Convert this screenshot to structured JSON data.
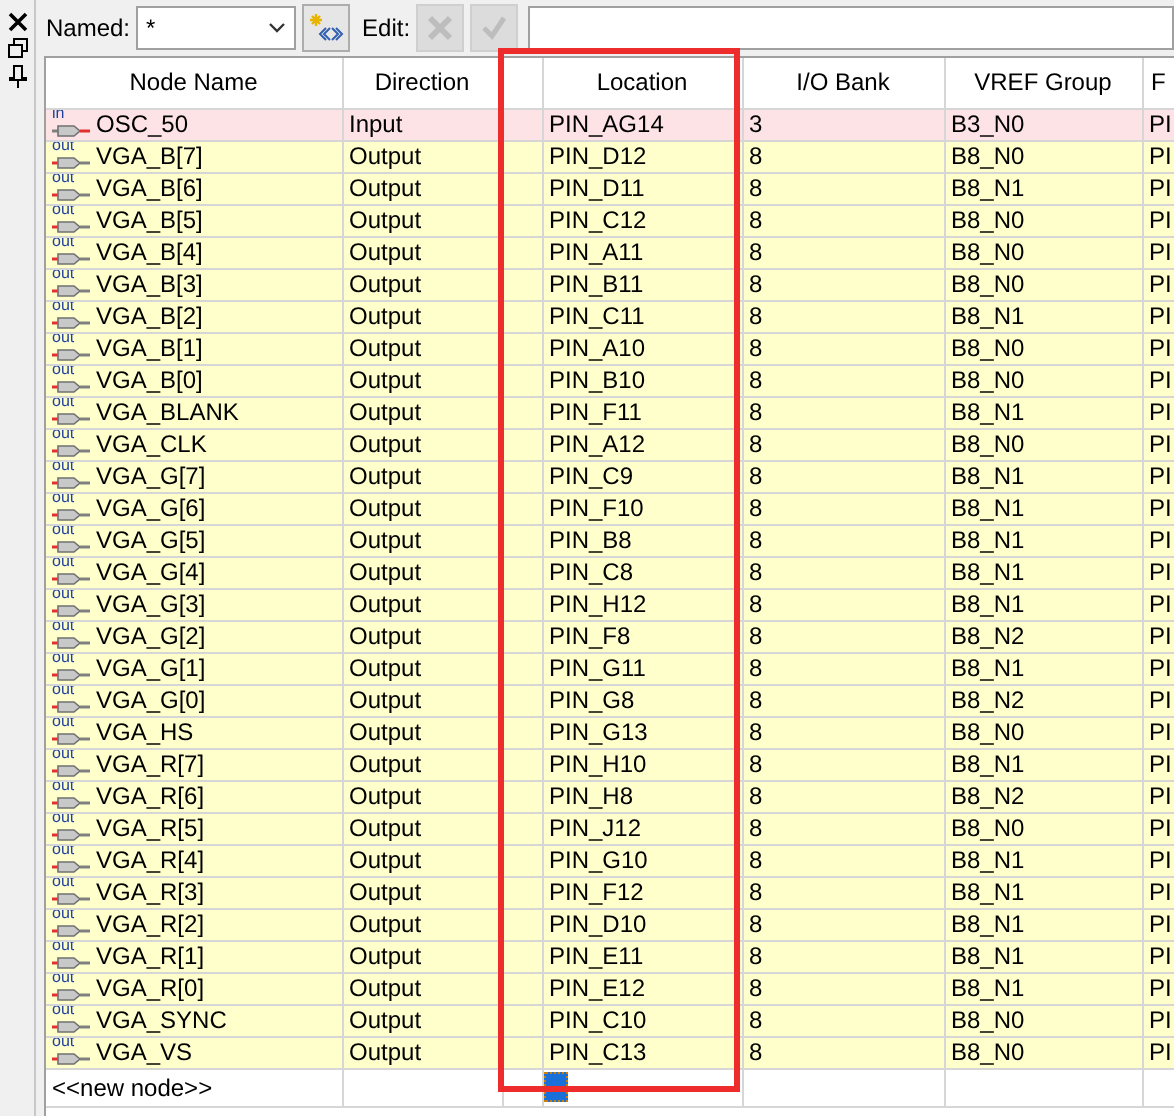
{
  "toolbar": {
    "named_label": "Named:",
    "named_value": "*",
    "edit_label": "Edit:",
    "edit_buttons": [
      {
        "kind": "cancel",
        "disabled": true
      },
      {
        "kind": "accept",
        "disabled": true
      }
    ]
  },
  "table": {
    "columns": [
      "Node Name",
      "Direction",
      "Location",
      "I/O Bank",
      "VREF Group",
      "F"
    ],
    "rows": [
      {
        "kind": "input",
        "pin_label": "in",
        "cells": [
          "OSC_50",
          "Input",
          "PIN_AG14",
          "3",
          "B3_N0",
          "PI"
        ]
      },
      {
        "kind": "output",
        "pin_label": "out",
        "cells": [
          "VGA_B[7]",
          "Output",
          "PIN_D12",
          "8",
          "B8_N0",
          "PI"
        ]
      },
      {
        "kind": "output",
        "pin_label": "out",
        "cells": [
          "VGA_B[6]",
          "Output",
          "PIN_D11",
          "8",
          "B8_N1",
          "PI"
        ]
      },
      {
        "kind": "output",
        "pin_label": "out",
        "cells": [
          "VGA_B[5]",
          "Output",
          "PIN_C12",
          "8",
          "B8_N0",
          "PI"
        ]
      },
      {
        "kind": "output",
        "pin_label": "out",
        "cells": [
          "VGA_B[4]",
          "Output",
          "PIN_A11",
          "8",
          "B8_N0",
          "PI"
        ]
      },
      {
        "kind": "output",
        "pin_label": "out",
        "cells": [
          "VGA_B[3]",
          "Output",
          "PIN_B11",
          "8",
          "B8_N0",
          "PI"
        ]
      },
      {
        "kind": "output",
        "pin_label": "out",
        "cells": [
          "VGA_B[2]",
          "Output",
          "PIN_C11",
          "8",
          "B8_N1",
          "PI"
        ]
      },
      {
        "kind": "output",
        "pin_label": "out",
        "cells": [
          "VGA_B[1]",
          "Output",
          "PIN_A10",
          "8",
          "B8_N0",
          "PI"
        ]
      },
      {
        "kind": "output",
        "pin_label": "out",
        "cells": [
          "VGA_B[0]",
          "Output",
          "PIN_B10",
          "8",
          "B8_N0",
          "PI"
        ]
      },
      {
        "kind": "output",
        "pin_label": "out",
        "cells": [
          "VGA_BLANK",
          "Output",
          "PIN_F11",
          "8",
          "B8_N1",
          "PI"
        ]
      },
      {
        "kind": "output",
        "pin_label": "out",
        "cells": [
          "VGA_CLK",
          "Output",
          "PIN_A12",
          "8",
          "B8_N0",
          "PI"
        ]
      },
      {
        "kind": "output",
        "pin_label": "out",
        "cells": [
          "VGA_G[7]",
          "Output",
          "PIN_C9",
          "8",
          "B8_N1",
          "PI"
        ]
      },
      {
        "kind": "output",
        "pin_label": "out",
        "cells": [
          "VGA_G[6]",
          "Output",
          "PIN_F10",
          "8",
          "B8_N1",
          "PI"
        ]
      },
      {
        "kind": "output",
        "pin_label": "out",
        "cells": [
          "VGA_G[5]",
          "Output",
          "PIN_B8",
          "8",
          "B8_N1",
          "PI"
        ]
      },
      {
        "kind": "output",
        "pin_label": "out",
        "cells": [
          "VGA_G[4]",
          "Output",
          "PIN_C8",
          "8",
          "B8_N1",
          "PI"
        ]
      },
      {
        "kind": "output",
        "pin_label": "out",
        "cells": [
          "VGA_G[3]",
          "Output",
          "PIN_H12",
          "8",
          "B8_N1",
          "PI"
        ]
      },
      {
        "kind": "output",
        "pin_label": "out",
        "cells": [
          "VGA_G[2]",
          "Output",
          "PIN_F8",
          "8",
          "B8_N2",
          "PI"
        ]
      },
      {
        "kind": "output",
        "pin_label": "out",
        "cells": [
          "VGA_G[1]",
          "Output",
          "PIN_G11",
          "8",
          "B8_N1",
          "PI"
        ]
      },
      {
        "kind": "output",
        "pin_label": "out",
        "cells": [
          "VGA_G[0]",
          "Output",
          "PIN_G8",
          "8",
          "B8_N2",
          "PI"
        ]
      },
      {
        "kind": "output",
        "pin_label": "out",
        "cells": [
          "VGA_HS",
          "Output",
          "PIN_G13",
          "8",
          "B8_N0",
          "PI"
        ]
      },
      {
        "kind": "output",
        "pin_label": "out",
        "cells": [
          "VGA_R[7]",
          "Output",
          "PIN_H10",
          "8",
          "B8_N1",
          "PI"
        ]
      },
      {
        "kind": "output",
        "pin_label": "out",
        "cells": [
          "VGA_R[6]",
          "Output",
          "PIN_H8",
          "8",
          "B8_N2",
          "PI"
        ]
      },
      {
        "kind": "output",
        "pin_label": "out",
        "cells": [
          "VGA_R[5]",
          "Output",
          "PIN_J12",
          "8",
          "B8_N0",
          "PI"
        ]
      },
      {
        "kind": "output",
        "pin_label": "out",
        "cells": [
          "VGA_R[4]",
          "Output",
          "PIN_G10",
          "8",
          "B8_N1",
          "PI"
        ]
      },
      {
        "kind": "output",
        "pin_label": "out",
        "cells": [
          "VGA_R[3]",
          "Output",
          "PIN_F12",
          "8",
          "B8_N1",
          "PI"
        ]
      },
      {
        "kind": "output",
        "pin_label": "out",
        "cells": [
          "VGA_R[2]",
          "Output",
          "PIN_D10",
          "8",
          "B8_N1",
          "PI"
        ]
      },
      {
        "kind": "output",
        "pin_label": "out",
        "cells": [
          "VGA_R[1]",
          "Output",
          "PIN_E11",
          "8",
          "B8_N1",
          "PI"
        ]
      },
      {
        "kind": "output",
        "pin_label": "out",
        "cells": [
          "VGA_R[0]",
          "Output",
          "PIN_E12",
          "8",
          "B8_N1",
          "PI"
        ]
      },
      {
        "kind": "output",
        "pin_label": "out",
        "cells": [
          "VGA_SYNC",
          "Output",
          "PIN_C10",
          "8",
          "B8_N0",
          "PI"
        ]
      },
      {
        "kind": "output",
        "pin_label": "out",
        "cells": [
          "VGA_VS",
          "Output",
          "PIN_C13",
          "8",
          "B8_N0",
          "PI"
        ]
      }
    ],
    "new_node": {
      "label": "<<new node>>",
      "location_cursor": true
    }
  }
}
